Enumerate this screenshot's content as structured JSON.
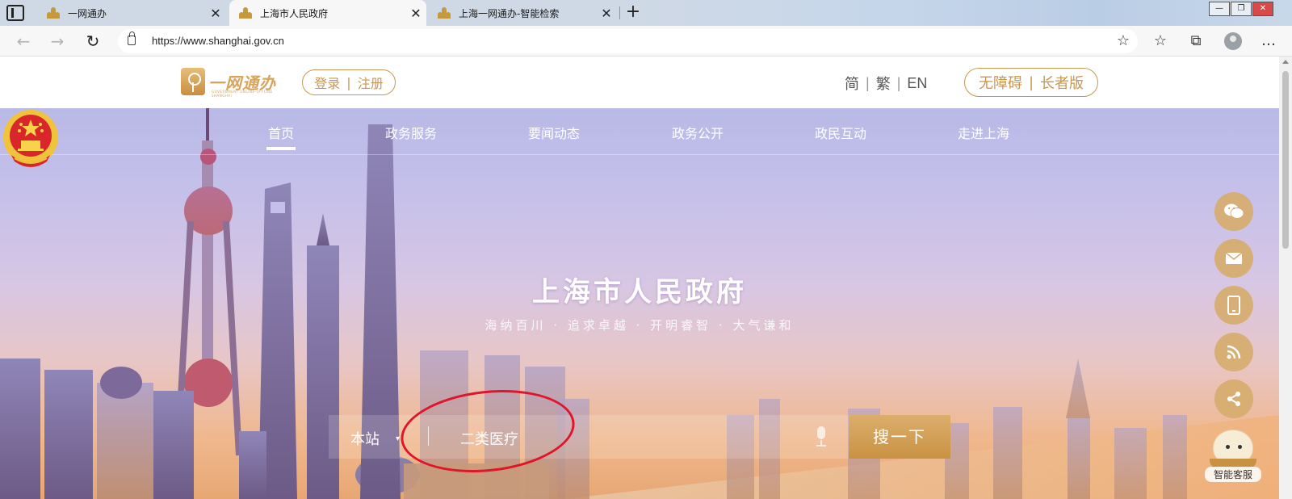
{
  "browser": {
    "tabs": [
      {
        "title": "一网通办",
        "active": false
      },
      {
        "title": "上海市人民政府",
        "active": true
      },
      {
        "title": "上海一网通办-智能检索",
        "active": false
      }
    ],
    "new_tab_label": "+",
    "window_controls": {
      "minimize": "—",
      "restore": "❐",
      "close": "✕"
    },
    "url": "https://www.shanghai.gov.cn",
    "nav": {
      "back": "←",
      "forward": "→",
      "reload": "↻"
    },
    "toolbar_icons": {
      "favorite_star": "☆",
      "favorites": "☆",
      "collections": "⧉",
      "more": "…"
    }
  },
  "header": {
    "logo_text": "一网通办",
    "logo_sub": "GOVERNMENT ONLINE-OFFLINE SHANGHAI",
    "login": "登录",
    "register": "注册",
    "languages": [
      "简",
      "繁",
      "EN"
    ],
    "accessibility": "无障碍",
    "elder_mode": "长者版"
  },
  "nav": {
    "items": [
      "首页",
      "政务服务",
      "要闻动态",
      "政务公开",
      "政民互动",
      "走进上海"
    ],
    "active_index": 0
  },
  "hero": {
    "title": "上海市人民政府",
    "slogan": "海纳百川 · 追求卓越 · 开明睿智 · 大气谦和"
  },
  "search": {
    "scope": "本站",
    "query": "二类医疗",
    "button": "搜一下"
  },
  "floating": {
    "buttons": [
      "wechat-icon",
      "mail-icon",
      "mobile-icon",
      "rss-icon",
      "share-icon"
    ],
    "assistant_label": "智能客服"
  },
  "colors": {
    "gold": "#c9974f",
    "annotation_red": "#e0142a"
  }
}
